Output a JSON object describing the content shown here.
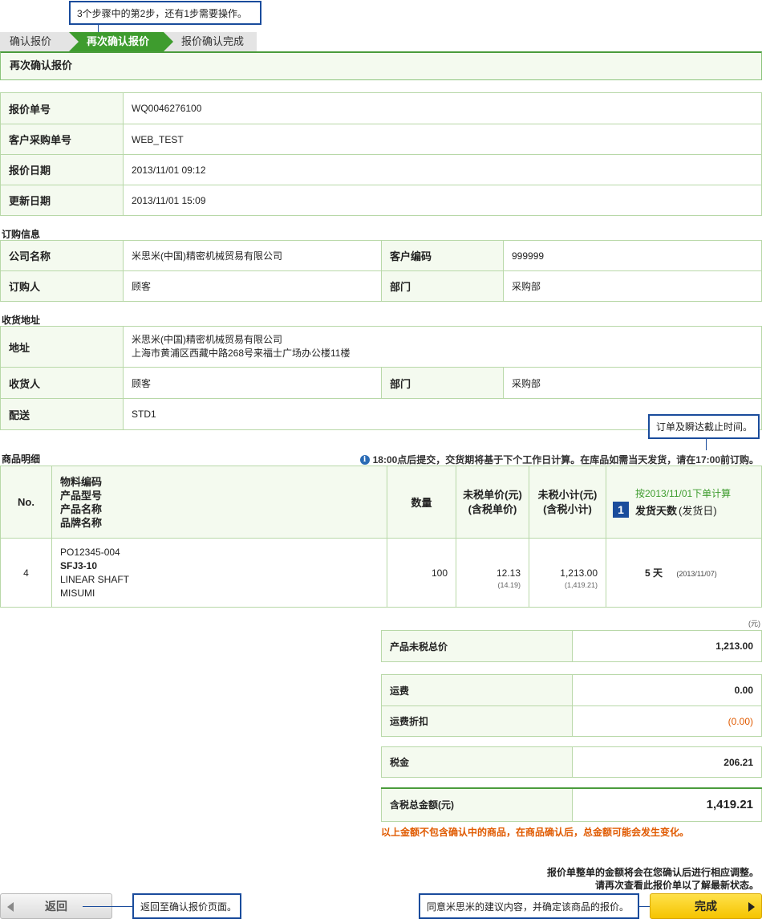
{
  "callouts": {
    "step_hint": "3个步骤中的第2步，还有1步需要操作。",
    "cutoff_hint": "订单及瞬达截止时间。",
    "back_hint": "返回至确认报价页面。",
    "done_hint": "同意米思米的建议内容，并确定该商品的报价。"
  },
  "steps": {
    "step1": "确认报价",
    "step2": "再次确认报价",
    "step3": "报价确认完成"
  },
  "page_title": "再次确认报价",
  "quote": {
    "rows": [
      {
        "label": "报价单号",
        "value": "WQ0046276100"
      },
      {
        "label": "客户采购单号",
        "value": "WEB_TEST"
      },
      {
        "label": "报价日期",
        "value": "2013/11/01 09:12"
      },
      {
        "label": "更新日期",
        "value": "2013/11/01 15:09"
      }
    ]
  },
  "order_info": {
    "title": "订购信息",
    "company_label": "公司名称",
    "company_value": "米思米(中国)精密机械贸易有限公司",
    "customer_code_label": "客户编码",
    "customer_code_value": "999999",
    "orderer_label": "订购人",
    "orderer_value": "顾客",
    "dept_label": "部门",
    "dept_value": "采购部"
  },
  "ship_info": {
    "title": "收货地址",
    "address_label": "地址",
    "address_line1": "米思米(中国)精密机械贸易有限公司",
    "address_line2": "上海市黄浦区西藏中路268号来福士广场办公楼11楼",
    "receiver_label": "收货人",
    "receiver_value": "顾客",
    "dept_label": "部门",
    "dept_value": "采购部",
    "delivery_label": "配送",
    "delivery_value": "STD1"
  },
  "items": {
    "title": "商品明细",
    "note": "18:00点后提交，交货期将基于下个工作日计算。在库品如需当天发货，请在17:00前订购。",
    "headers": {
      "no": "No.",
      "codes": [
        "物料编码",
        "产品型号",
        "产品名称",
        "品牌名称"
      ],
      "qty": "数量",
      "unit_price": "未税单价(元)",
      "unit_price_tax": "(含税单价)",
      "subtotal": "未税小计(元)",
      "subtotal_tax": "(含税小计)",
      "ship_basis": "按2013/11/01下单计算",
      "ship_badge": "1",
      "ship_days": "发货天数",
      "ship_date_label": "(发货日)"
    },
    "rows": [
      {
        "no": "4",
        "material_code": "PO12345-004",
        "model": "SFJ3-10",
        "product_name": "LINEAR SHAFT",
        "brand": "MISUMI",
        "qty": "100",
        "unit_price": "12.13",
        "unit_price_tax": "(14.19)",
        "subtotal": "1,213.00",
        "subtotal_tax": "(1,419.21)",
        "ship_days": "5 天",
        "ship_date": "(2013/11/07)"
      }
    ]
  },
  "summary": {
    "unit": "(元)",
    "net_total_label": "产品未税总价",
    "net_total_value": "1,213.00",
    "freight_label": "运费",
    "freight_value": "0.00",
    "freight_discount_label": "运费折扣",
    "freight_discount_value": "(0.00)",
    "tax_label": "税金",
    "tax_value": "206.21",
    "grand_total_label": "含税总金额(元)",
    "grand_total_value": "1,419.21",
    "warning": "以上金额不包含确认中的商品，在商品确认后，总金额可能会发生变化。"
  },
  "footer": {
    "notice1": "报价单整单的金额将会在您确认后进行相应调整。",
    "notice2": "请再次查看此报价单以了解最新状态。",
    "back_label": "返回",
    "done_label": "完成"
  },
  "colors": {
    "accent_green": "#3e9c2e",
    "callout_blue": "#1a4c9c",
    "warning_orange": "#e05a00",
    "done_yellow": "#f5c400"
  }
}
